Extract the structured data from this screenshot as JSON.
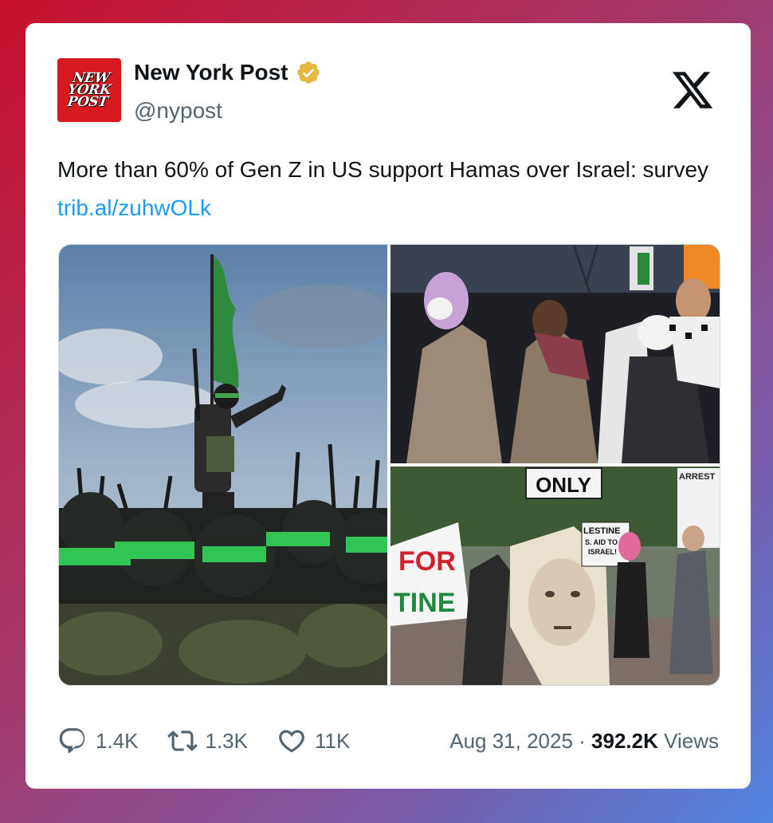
{
  "account": {
    "avatar_text_lines": [
      "NEW",
      "YORK",
      "POST"
    ],
    "name": "New York Post",
    "handle": "@nypost",
    "verified_icon": "gold-verified-badge"
  },
  "platform_logo": "x-logo",
  "tweet": {
    "text": "More than 60% of Gen Z in US support Hamas over Israel: survey ",
    "link": "trib.al/zuhwOLk"
  },
  "media": {
    "images": [
      {
        "id": "left",
        "sign_text": ""
      },
      {
        "id": "top-right",
        "sign_text": ""
      },
      {
        "id": "bottom-right",
        "sign_text": [
          "ONLY",
          "FOR",
          "TINE",
          "LESTINE",
          "S. AID TO",
          "ISRAEL!",
          "ARREST"
        ]
      }
    ]
  },
  "stats": {
    "replies": "1.4K",
    "reposts": "1.3K",
    "likes": "11K",
    "date": "Aug 31, 2025",
    "separator": " · ",
    "views_count": "392.2K",
    "views_label": " Views"
  },
  "colors": {
    "brand_red": "#d71920",
    "link": "#1d9bf0",
    "text": "#0f1419",
    "muted": "#536471",
    "verified_gold": "#e7b73f"
  }
}
